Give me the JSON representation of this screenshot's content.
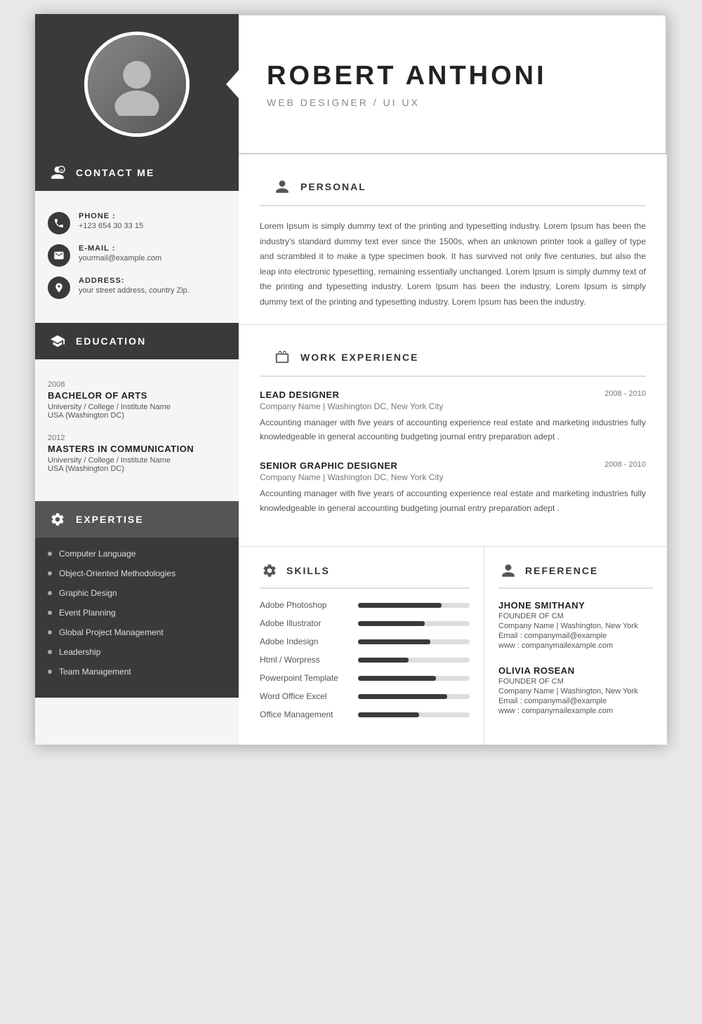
{
  "header": {
    "name": "ROBERT ANTHONI",
    "title": "WEB DESIGNER / UI UX"
  },
  "contact": {
    "section_label": "CONTACT ME",
    "phone_label": "PHONE :",
    "phone_value": "+123 654 30 33 15",
    "email_label": "E-MAIL :",
    "email_value": "yourmail@example.com",
    "address_label": "ADDRESS:",
    "address_value": "your street address, country Zip."
  },
  "education": {
    "section_label": "EDUCATION",
    "items": [
      {
        "year": "2008",
        "degree": "BACHELOR OF ARTS",
        "school": "University / College / Institute Name",
        "location": "USA (Washington DC)"
      },
      {
        "year": "2012",
        "degree": "MASTERS IN COMMUNICATION",
        "school": "University / College / Institute Name",
        "location": "USA (Washington DC)"
      }
    ]
  },
  "expertise": {
    "section_label": "EXPERTISE",
    "items": [
      "Computer Language",
      "Object-Oriented Methodologies",
      "Graphic Design",
      "Event Planning",
      "Global Project Management",
      "Leadership",
      "Team Management"
    ]
  },
  "personal": {
    "section_label": "PERSONAL",
    "text": "Lorem Ipsum is simply dummy text of the printing and typesetting industry. Lorem Ipsum has been the industry's standard dummy text ever since the 1500s, when an unknown printer took a galley of type and scrambled it to make a type specimen book. It has survived not only five centuries, but also the leap into electronic typesetting, remaining essentially unchanged. Lorem Ipsum is simply dummy text of the printing and typesetting industry. Lorem Ipsum has been the industry, Lorem Ipsum is simply dummy text of the printing and typesetting industry. Lorem Ipsum has been the industry."
  },
  "work_experience": {
    "section_label": "WORK EXPERIENCE",
    "jobs": [
      {
        "title": "LEAD DESIGNER",
        "dates": "2008 - 2010",
        "company": "Company Name  |  Washington DC, New York City",
        "description": "Accounting manager with five years of accounting experience real estate and marketing industries fully knowledgeable in general accounting budgeting journal entry preparation adept ."
      },
      {
        "title": "SENIOR GRAPHIC DESIGNER",
        "dates": "2008 - 2010",
        "company": "Company Name  |  Washington DC, New York City",
        "description": "Accounting manager with five years of accounting experience real estate and marketing industries fully knowledgeable in general accounting budgeting journal entry preparation adept ."
      }
    ]
  },
  "skills": {
    "section_label": "SKILLS",
    "items": [
      {
        "name": "Adobe Photoshop",
        "percent": 75
      },
      {
        "name": "Adobe Illustrator",
        "percent": 60
      },
      {
        "name": "Adobe Indesign",
        "percent": 65
      },
      {
        "name": "Html / Worpress",
        "percent": 45
      },
      {
        "name": "Powerpoint Template",
        "percent": 70
      },
      {
        "name": "Word Office Excel",
        "percent": 80
      },
      {
        "name": "Office Management",
        "percent": 55
      }
    ]
  },
  "reference": {
    "section_label": "REFERENCE",
    "items": [
      {
        "name": "JHONE SMITHANY",
        "role": "FOUNDER OF CM",
        "company": "Company Name  |  Washington, New York",
        "email": "Email : companymail@example",
        "website": "www : companymailexample.com"
      },
      {
        "name": "OLIVIA ROSEAN",
        "role": "FOUNDER OF CM",
        "company": "Company Name  |  Washington, New York",
        "email": "Email : companymail@example",
        "website": "www : companymailexample.com"
      }
    ]
  }
}
